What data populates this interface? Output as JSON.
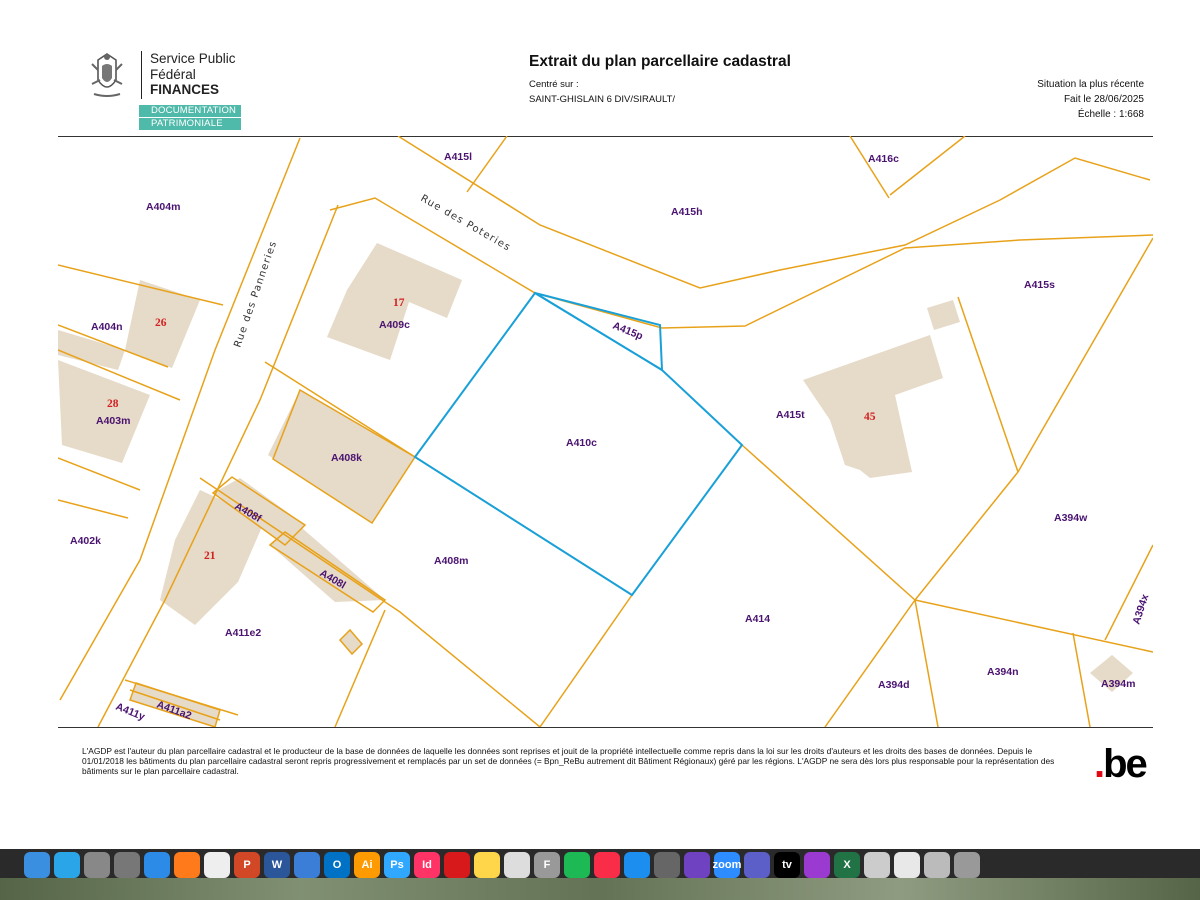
{
  "header": {
    "org_line1": "Service Public",
    "org_line2": "Fédéral",
    "org_line3": "FINANCES",
    "dept_line1": "DOCUMENTATION",
    "dept_line2": "PATRIMONIALE",
    "title": "Extrait du plan parcellaire cadastral",
    "centre_label": "Centré sur :",
    "centre_value": "SAINT-GHISLAIN 6 DIV/SIRAULT/",
    "situation": "Situation la plus récente",
    "date": "Fait le 28/06/2025",
    "scale": "Échelle : 1:668"
  },
  "map": {
    "parcel_color": "#e8a21a",
    "highlight_color": "#1aa0d8",
    "building_color": "#e6dac8",
    "streets": [
      "Rue des Poteries",
      "Rue des Panneries"
    ],
    "parcels": [
      "A415l",
      "A416c",
      "A404m",
      "A415h",
      "A415s",
      "A404n",
      "A409c",
      "A415p",
      "A403m",
      "A408k",
      "A410c",
      "A415t",
      "A408f",
      "A394w",
      "A402k",
      "A408l",
      "A408m",
      "A394x",
      "A411e2",
      "A414",
      "A394d",
      "A394n",
      "A394m",
      "A411a2",
      "A411y"
    ],
    "house_numbers": [
      "17",
      "26",
      "28",
      "45",
      "21"
    ]
  },
  "footer": {
    "disclaimer": "L'AGDP est l'auteur du plan parcellaire cadastral et le producteur de la base de données de laquelle les données sont reprises et jouit de la propriété intellectuelle comme repris dans la loi sur les droits d'auteurs et les droits des bases de données. Depuis le 01/01/2018 les bâtiments du plan parcellaire cadastral seront repris progressivement et remplacés par un set de données (= Bpn_ReBu autrement dit Bâtiment Régionaux) géré par les régions. L'AGDP ne sera dès lors plus responsable pour la représentation des bâtiments sur le plan parcellaire cadastral.",
    "logo_dot": ".",
    "logo_text": "be"
  },
  "dock": {
    "apps": [
      "finder-icon",
      "quicktime-icon",
      "system-preferences-icon",
      "launchpad-icon",
      "safari-icon",
      "firefox-icon",
      "chrome-icon",
      "powerpoint-icon",
      "word-icon",
      "mail-icon",
      "outlook-icon",
      "illustrator-icon",
      "photoshop-icon",
      "indesign-icon",
      "acrobat-icon",
      "notes-icon",
      "texteditor-icon",
      "fontbook-icon",
      "spotify-icon",
      "music-icon",
      "appstore-icon",
      "screenshot-icon",
      "imovie-icon",
      "zoom-icon",
      "teams-icon",
      "appletv-icon",
      "podcasts-icon",
      "excel-icon",
      "preview-icon",
      "photos-icon",
      "documents-icon",
      "trash-icon"
    ],
    "labels": [
      "",
      "",
      "",
      "",
      "",
      "",
      "",
      "P",
      "W",
      "",
      "O",
      "Ai",
      "Ps",
      "Id",
      "",
      "",
      "",
      "F",
      "",
      "",
      "",
      "",
      "",
      "zoom",
      "",
      "tv",
      "",
      "X",
      "",
      "",
      "",
      ""
    ]
  }
}
